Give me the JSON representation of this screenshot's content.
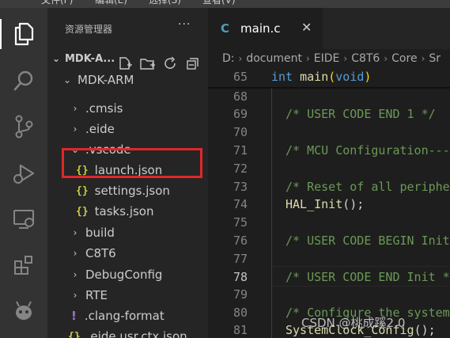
{
  "menubar": {
    "items": [
      "文件(F)",
      "编辑(E)",
      "选择(S)",
      "查看(V)"
    ]
  },
  "activity_bar": {
    "items": [
      {
        "name": "explorer-icon",
        "active": true
      },
      {
        "name": "search-icon",
        "active": false
      },
      {
        "name": "source-control-icon",
        "active": false
      },
      {
        "name": "run-debug-icon",
        "active": false
      },
      {
        "name": "remote-explorer-icon",
        "active": false
      },
      {
        "name": "extensions-icon",
        "active": false
      },
      {
        "name": "eide-icon",
        "active": false
      }
    ]
  },
  "sidebar": {
    "title": "资源管理器",
    "more": "···",
    "workspace": "MDK-A...",
    "tree": [
      {
        "label": "MDK-ARM",
        "kind": "folder-open"
      },
      {
        "label": ".cmsis",
        "kind": "folder"
      },
      {
        "label": ".eide",
        "kind": "folder"
      },
      {
        "label": ".vscode",
        "kind": "folder-open"
      },
      {
        "label": "launch.json",
        "kind": "json",
        "highlighted": true
      },
      {
        "label": "settings.json",
        "kind": "json"
      },
      {
        "label": "tasks.json",
        "kind": "json"
      },
      {
        "label": "build",
        "kind": "folder"
      },
      {
        "label": "C8T6",
        "kind": "folder"
      },
      {
        "label": "DebugConfig",
        "kind": "folder"
      },
      {
        "label": "RTE",
        "kind": "folder"
      },
      {
        "label": ".clang-format",
        "kind": "config"
      },
      {
        "label": ".eide.usr.ctx.json",
        "kind": "json"
      }
    ],
    "icons": {
      "json": "{}",
      "config": "!",
      "chevron_right": "›",
      "chevron_down": "⌄"
    }
  },
  "editor": {
    "tab": {
      "icon": "C",
      "name": "main.c",
      "close": "✕"
    },
    "breadcrumb": [
      "D:",
      "document",
      "EIDE",
      "C8T6",
      "Core",
      "Sr"
    ],
    "sticky": {
      "line": "65",
      "code_kw": "int",
      "code_fn": "main",
      "code_paren_open": "(",
      "code_arg": "void",
      "code_paren_close": ")"
    },
    "current_line": "78",
    "lines": [
      {
        "n": "68",
        "text": ""
      },
      {
        "n": "69",
        "text": "/* USER CODE END 1 */",
        "type": "comment"
      },
      {
        "n": "70",
        "text": ""
      },
      {
        "n": "71",
        "text": "/* MCU Configuration---",
        "type": "comment"
      },
      {
        "n": "72",
        "text": ""
      },
      {
        "n": "73",
        "text": "/* Reset of all periphe",
        "type": "comment"
      },
      {
        "n": "74",
        "text": "HAL_Init();",
        "type": "call",
        "fn": "HAL_Init",
        "rest": "();"
      },
      {
        "n": "75",
        "text": ""
      },
      {
        "n": "76",
        "text": "/* USER CODE BEGIN Init",
        "type": "comment"
      },
      {
        "n": "77",
        "text": ""
      },
      {
        "n": "78",
        "text": "/* USER CODE END Init *",
        "type": "comment"
      },
      {
        "n": "79",
        "text": ""
      },
      {
        "n": "80",
        "text": "/* Configure the system",
        "type": "comment"
      },
      {
        "n": "81",
        "text": "SystemClock_Config();",
        "type": "call",
        "fn": "SystemClock_Config",
        "rest": "();"
      }
    ]
  },
  "watermark": "CSDN @桃成蹊2.0",
  "colors": {
    "accent": "#007acc",
    "highlight_box": "#e0272a",
    "comment": "#6a9955",
    "keyword": "#569cd6",
    "function": "#dcdcaa",
    "json_icon": "#cbcb41"
  }
}
